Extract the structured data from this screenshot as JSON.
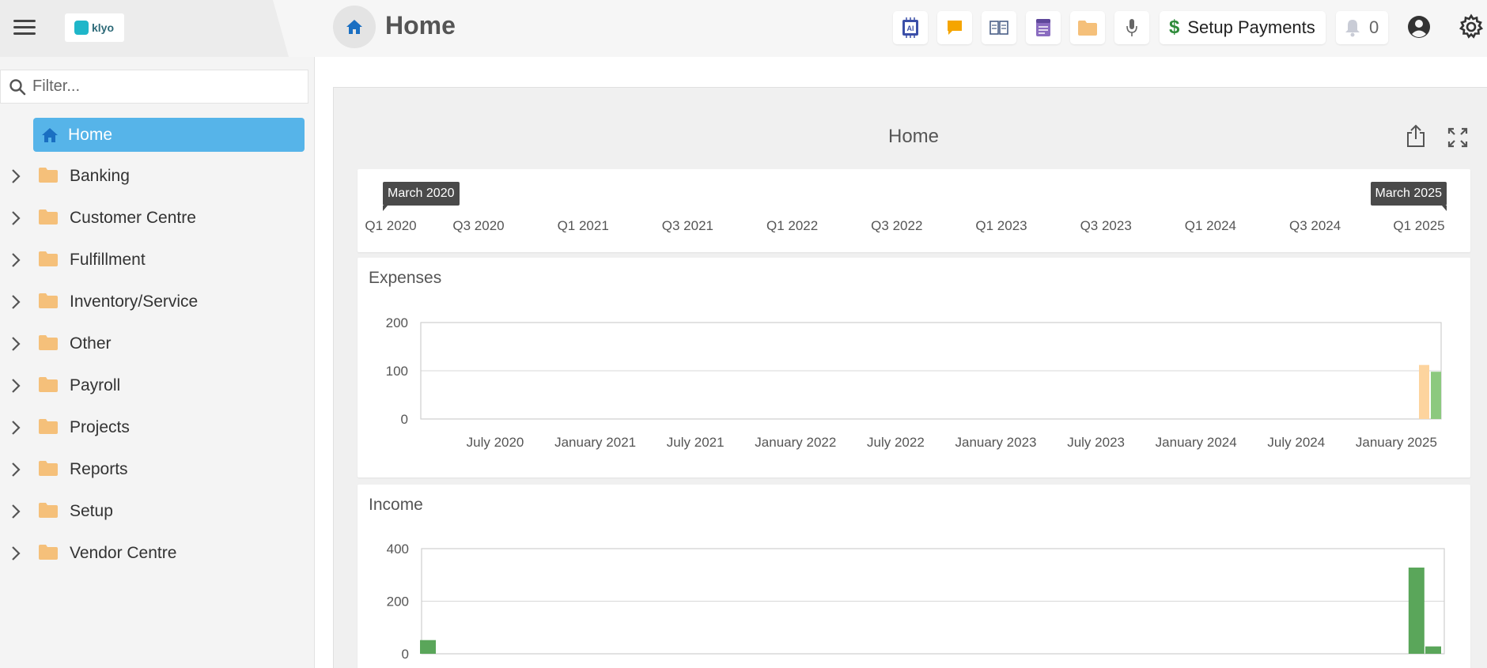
{
  "header": {
    "logo_text": "klyo",
    "page_title": "Home",
    "toolbar_icons": [
      "ai-chip-icon",
      "chat-icon",
      "book-icon",
      "notes-icon",
      "folder-icon",
      "microphone-icon"
    ],
    "setup_payments_label": "Setup Payments",
    "notification_count": "0"
  },
  "sidebar": {
    "filter_placeholder": "Filter...",
    "home_label": "Home",
    "items": [
      {
        "label": "Banking"
      },
      {
        "label": "Customer Centre"
      },
      {
        "label": "Fulfillment"
      },
      {
        "label": "Inventory/Service"
      },
      {
        "label": "Other"
      },
      {
        "label": "Payroll"
      },
      {
        "label": "Projects"
      },
      {
        "label": "Reports"
      },
      {
        "label": "Setup"
      },
      {
        "label": "Vendor Centre"
      }
    ]
  },
  "main": {
    "panel_title": "Home",
    "timeline": {
      "start_tag": "March 2020",
      "end_tag": "March 2025",
      "labels": [
        "Q1 2020",
        "Q3 2020",
        "Q1 2021",
        "Q3 2021",
        "Q1 2022",
        "Q3 2022",
        "Q1 2023",
        "Q3 2023",
        "Q1 2024",
        "Q3 2024",
        "Q1 2025"
      ]
    },
    "expenses_title": "Expenses",
    "income_title": "Income"
  },
  "colors": {
    "accent": "#56b4e9",
    "folder": "#f5c07a",
    "bar_orange": "#fdd49e",
    "bar_green_light": "#8cc97f",
    "bar_green": "#5aa65a"
  },
  "chart_data": [
    {
      "type": "bar",
      "title": "Expenses",
      "ylim": [
        0,
        200
      ],
      "yticks": [
        0,
        100,
        200
      ],
      "xticks": [
        "July 2020",
        "January 2021",
        "July 2021",
        "January 2022",
        "July 2022",
        "January 2023",
        "July 2023",
        "January 2024",
        "July 2024",
        "January 2025"
      ],
      "series": [
        {
          "color": "#fdd49e",
          "x": [
            "March 2025"
          ],
          "values": [
            112
          ]
        },
        {
          "color": "#8cc97f",
          "x": [
            "March 2025"
          ],
          "values": [
            98
          ]
        }
      ]
    },
    {
      "type": "bar",
      "title": "Income",
      "ylim": [
        0,
        400
      ],
      "yticks": [
        0,
        200,
        400
      ],
      "series": [
        {
          "color": "#5aa65a",
          "x": [
            "March 2020",
            "February 2025",
            "March 2025"
          ],
          "values": [
            52,
            328,
            28
          ]
        }
      ]
    }
  ]
}
